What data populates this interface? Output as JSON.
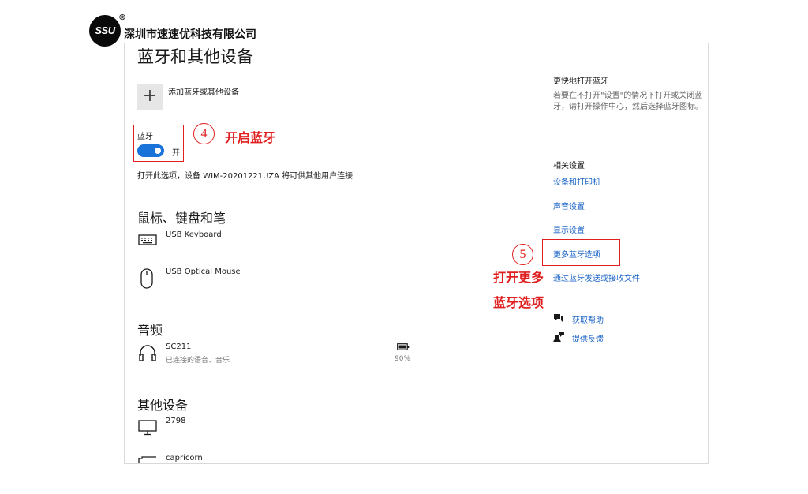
{
  "brand": {
    "logo_text": "SSU",
    "registered": "®",
    "company_name": "深圳市速速优科技有限公司"
  },
  "page": {
    "title": "蓝牙和其他设备",
    "add_device_label": "添加蓝牙或其他设备",
    "bluetooth_label": "蓝牙",
    "toggle_state": "开",
    "toggle_on": true,
    "discover_text": "打开此选项，设备 WIM-20201221UZA 将可供其他用户连接"
  },
  "annotations": {
    "step4_number": "4",
    "step4_text": "开启蓝牙",
    "step5_number": "5",
    "step5_line1": "打开更多",
    "step5_line2": "蓝牙选项",
    "color": "#e02020"
  },
  "sections": {
    "mouse_keyboard": {
      "heading": "鼠标、键盘和笔",
      "devices": [
        {
          "name": "USB Keyboard",
          "icon": "keyboard-icon"
        },
        {
          "name": "USB Optical Mouse",
          "icon": "mouse-icon"
        }
      ]
    },
    "audio": {
      "heading": "音频",
      "devices": [
        {
          "name": "SC211",
          "status": "已连接的语音、音乐",
          "battery": "90%",
          "icon": "headphones-icon"
        }
      ]
    },
    "other": {
      "heading": "其他设备",
      "devices": [
        {
          "name": "2798",
          "icon": "monitor-icon"
        },
        {
          "name": "capricorn",
          "icon": "device-icon"
        }
      ]
    }
  },
  "sidebar": {
    "quick_heading": "更快地打开蓝牙",
    "quick_text": "若要在不打开\"设置\"的情况下打开或关闭蓝牙，请打开操作中心，然后选择蓝牙图标。",
    "related_heading": "相关设置",
    "links": [
      "设备和打印机",
      "声音设置",
      "显示设置",
      "更多蓝牙选项",
      "通过蓝牙发送或接收文件"
    ],
    "help": "获取帮助",
    "feedback": "提供反馈",
    "link_color": "#1a63c6"
  }
}
